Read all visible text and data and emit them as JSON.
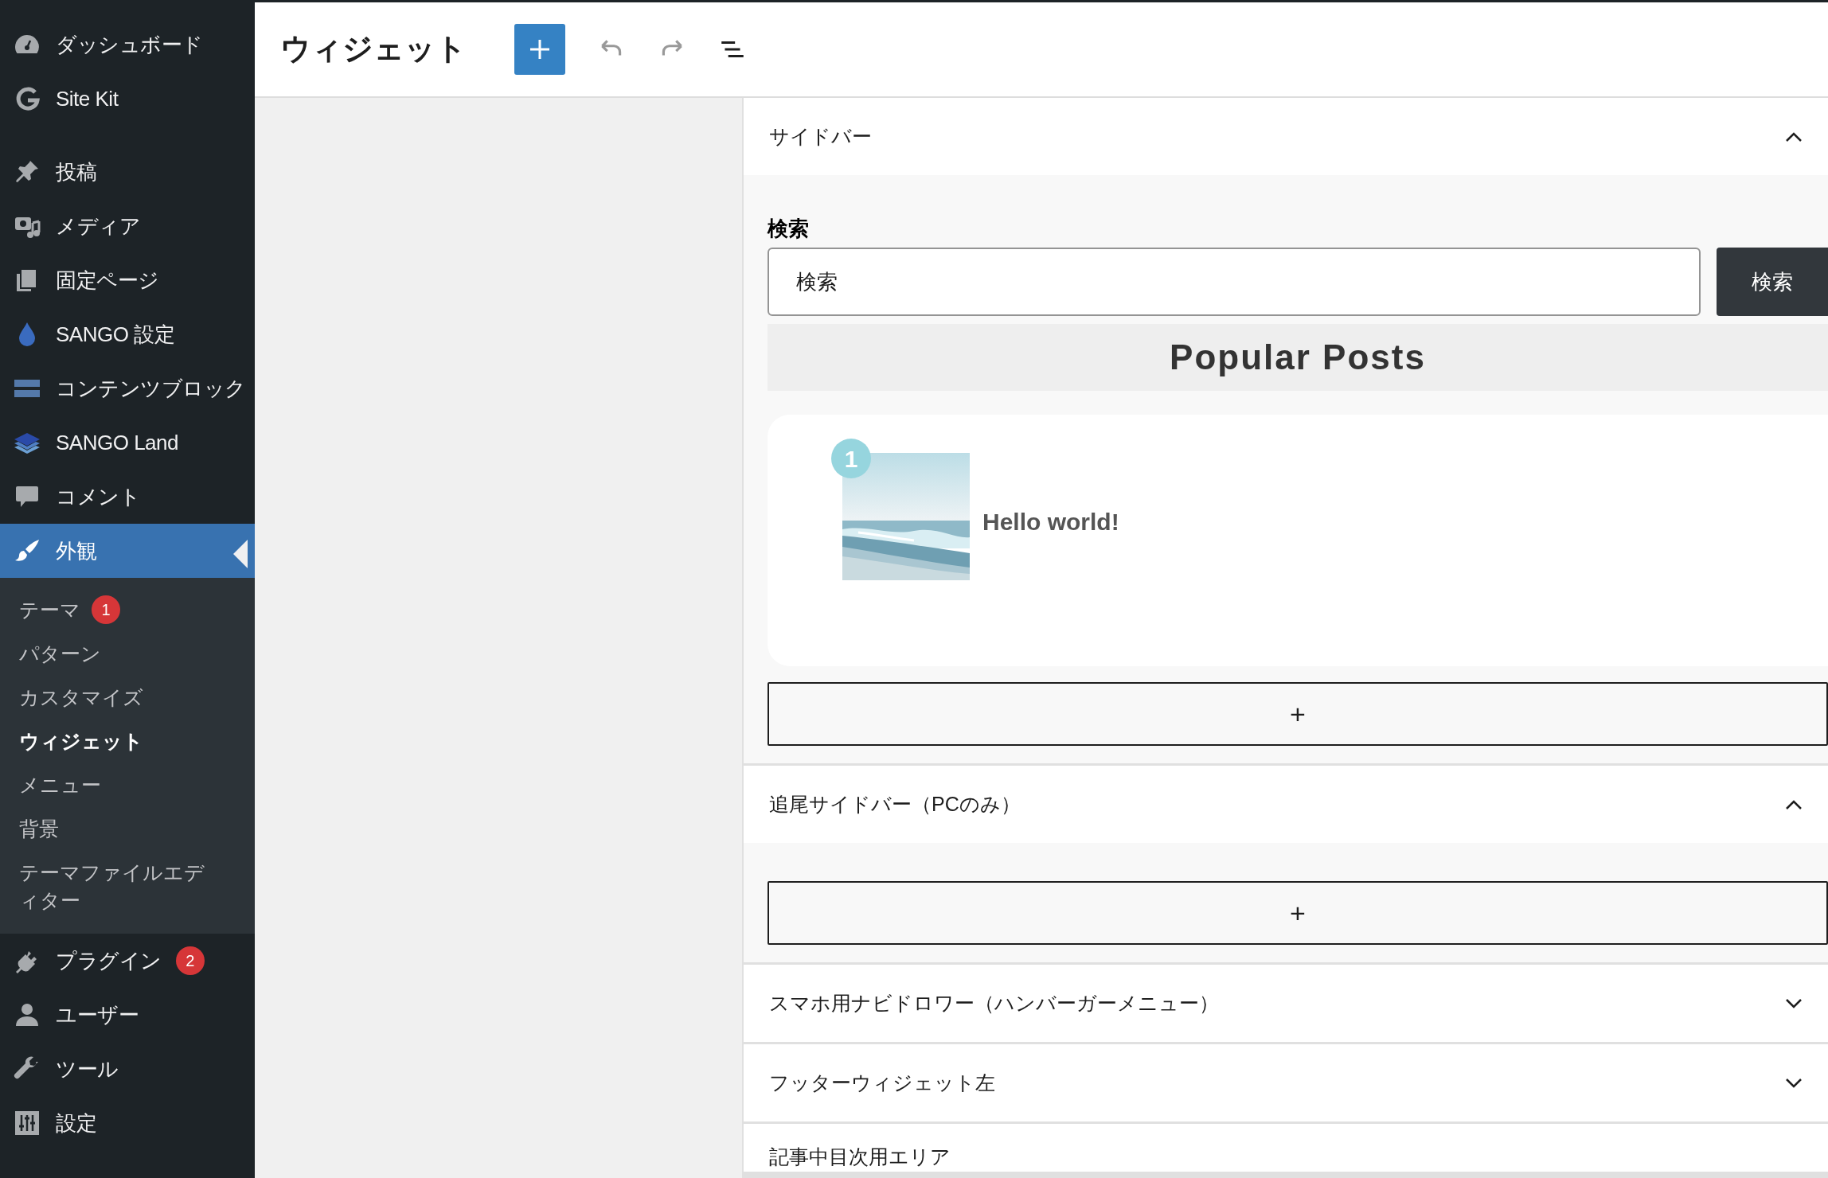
{
  "menu": [
    {
      "label": "ダッシュボード",
      "selected": false
    },
    {
      "label": "Site Kit",
      "selected": false,
      "gap_after": true
    },
    {
      "label": "投稿",
      "selected": false
    },
    {
      "label": "メディア",
      "selected": false
    },
    {
      "label": "固定ページ",
      "selected": false
    },
    {
      "label": "SANGO 設定",
      "selected": false
    },
    {
      "label": "コンテンツブロック",
      "selected": false
    },
    {
      "label": "SANGO Land",
      "selected": false
    },
    {
      "label": "コメント",
      "selected": false
    },
    {
      "label": "外観",
      "selected": true,
      "submenu": [
        {
          "label": "テーマ",
          "badge": "1",
          "selected": false
        },
        {
          "label": "パターン",
          "selected": false
        },
        {
          "label": "カスタマイズ",
          "selected": false
        },
        {
          "label": "ウィジェット",
          "selected": true
        },
        {
          "label": "メニュー",
          "selected": false
        },
        {
          "label": "背景",
          "selected": false
        },
        {
          "label": "テーマファイルエディター",
          "selected": false
        }
      ]
    },
    {
      "label": "プラグイン",
      "badge": "2",
      "selected": false
    },
    {
      "label": "ユーザー",
      "selected": false
    },
    {
      "label": "ツール",
      "selected": false
    },
    {
      "label": "設定",
      "selected": false
    }
  ],
  "header": {
    "title": "ウィジェット"
  },
  "areas": [
    {
      "title": "サイドバー",
      "expanded": true,
      "blocks": [
        {
          "kind": "search",
          "label": "検索",
          "placeholder": "検索",
          "button": "検索"
        },
        {
          "kind": "heading",
          "text": "Popular Posts"
        },
        {
          "kind": "posts",
          "posts": [
            {
              "rank": "1",
              "title": "Hello world!"
            }
          ]
        },
        {
          "kind": "appender",
          "text": "+"
        }
      ]
    },
    {
      "title": "追尾サイドバー（PCのみ）",
      "expanded": true,
      "blocks": [
        {
          "kind": "appender",
          "text": "+"
        }
      ]
    },
    {
      "title": "スマホ用ナビドロワー（ハンバーガーメニュー）",
      "expanded": false
    },
    {
      "title": "フッターウィジェット左",
      "expanded": false
    },
    {
      "title": "記事中目次用エリア",
      "expanded": false,
      "partial": true
    }
  ]
}
